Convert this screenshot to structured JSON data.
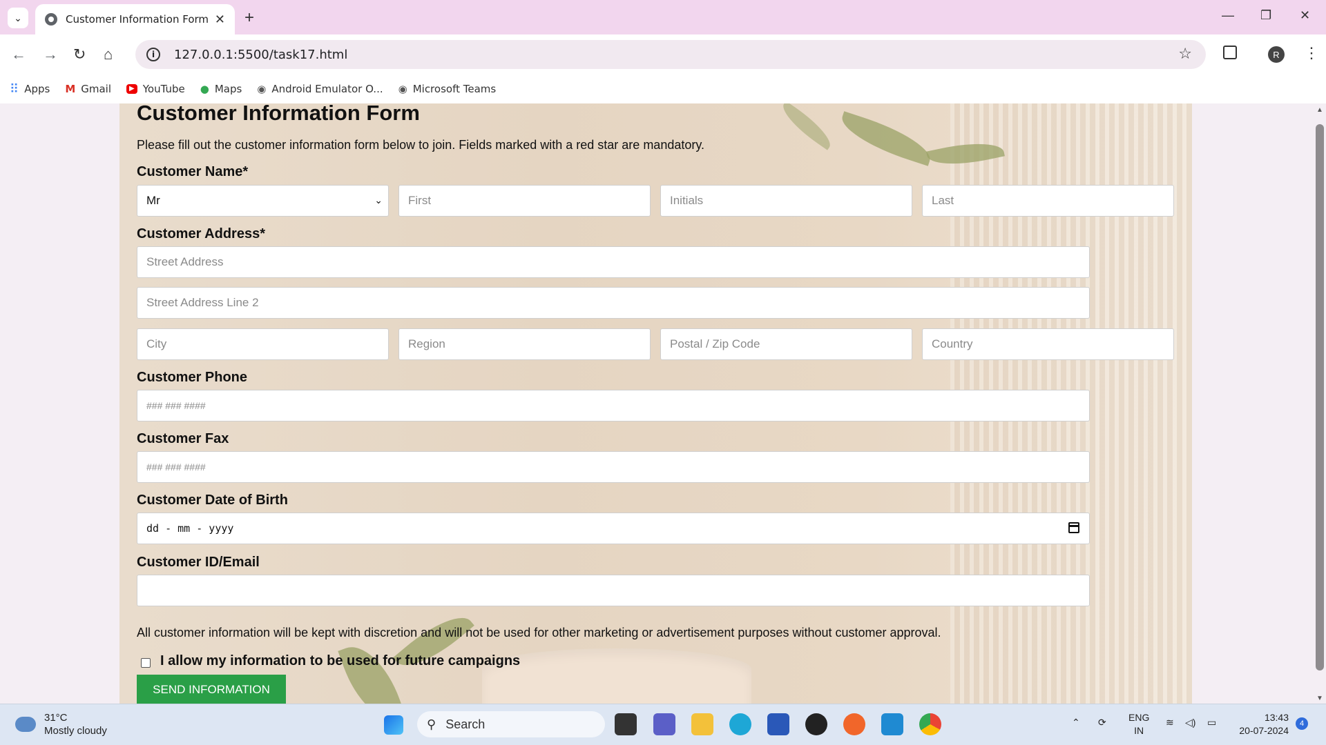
{
  "browser": {
    "tab_title": "Customer Information Form",
    "url": "127.0.0.1:5500/task17.html",
    "new_tab": "+",
    "profile_initial": "R",
    "bookmarks": [
      {
        "label": "Apps",
        "icon": "apps-grid-icon"
      },
      {
        "label": "Gmail",
        "icon": "gmail-icon"
      },
      {
        "label": "YouTube",
        "icon": "youtube-icon"
      },
      {
        "label": "Maps",
        "icon": "maps-pin-icon"
      },
      {
        "label": "Android Emulator O...",
        "icon": "globe-icon"
      },
      {
        "label": "Microsoft Teams",
        "icon": "globe-icon"
      }
    ]
  },
  "form": {
    "title": "Customer Information Form",
    "intro": "Please fill out the customer information form below to join. Fields marked with a red star are mandatory.",
    "name_label": "Customer Name*",
    "title_select": "Mr",
    "first_placeholder": "First",
    "initials_placeholder": "Initials",
    "last_placeholder": "Last",
    "address_label": "Customer Address*",
    "street_placeholder": "Street Address",
    "street2_placeholder": "Street Address Line 2",
    "city_placeholder": "City",
    "region_placeholder": "Region",
    "postal_placeholder": "Postal / Zip Code",
    "country_placeholder": "Country",
    "phone_label": "Customer Phone",
    "phone_placeholder": "### ### ####",
    "fax_label": "Customer Fax",
    "fax_placeholder": "### ### ####",
    "dob_label": "Customer Date of Birth",
    "dob_placeholder": "dd - mm - yyyy",
    "email_label": "Customer ID/Email",
    "email_value": "",
    "privacy_note": "All customer information will be kept with discretion and will not be used for other marketing or advertisement purposes without customer approval.",
    "consent_label": "I allow my information to be used for future campaigns",
    "consent_checked": false,
    "submit_label": "SEND INFORMATION"
  },
  "taskbar": {
    "temperature": "31°C",
    "weather": "Mostly cloudy",
    "search_label": "Search",
    "lang_top": "ENG",
    "lang_bottom": "IN",
    "time": "13:43",
    "date": "20-07-2024",
    "notification_count": "4"
  },
  "colors": {
    "submit_bg": "#2a9f47",
    "tab_strip": "#f2d6ee"
  }
}
